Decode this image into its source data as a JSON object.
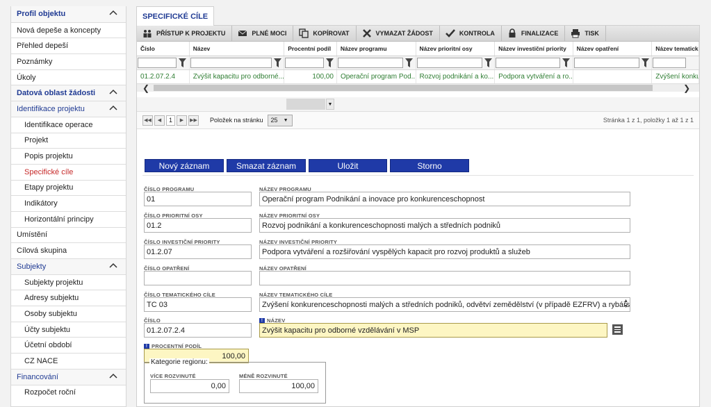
{
  "sidebar": {
    "items": [
      {
        "label": "Profil objektu",
        "kind": "sec",
        "chevron": true
      },
      {
        "label": "Nová depeše a koncepty",
        "kind": "item"
      },
      {
        "label": "Přehled depeší",
        "kind": "item"
      },
      {
        "label": "Poznámky",
        "kind": "item"
      },
      {
        "label": "Úkoly",
        "kind": "item"
      },
      {
        "label": "Datová oblast žádosti",
        "kind": "sec",
        "chevron": true
      },
      {
        "label": "Identifikace projektu",
        "kind": "secplain",
        "chevron": true
      },
      {
        "label": "Identifikace operace",
        "kind": "sub"
      },
      {
        "label": "Projekt",
        "kind": "sub"
      },
      {
        "label": "Popis projektu",
        "kind": "sub"
      },
      {
        "label": "Specifické cíle",
        "kind": "sub",
        "active": true
      },
      {
        "label": "Etapy projektu",
        "kind": "sub"
      },
      {
        "label": "Indikátory",
        "kind": "sub"
      },
      {
        "label": "Horizontální principy",
        "kind": "sub"
      },
      {
        "label": "Umístění",
        "kind": "item"
      },
      {
        "label": "Cílová skupina",
        "kind": "item"
      },
      {
        "label": "Subjekty",
        "kind": "secplain",
        "chevron": true
      },
      {
        "label": "Subjekty projektu",
        "kind": "sub"
      },
      {
        "label": "Adresy subjektu",
        "kind": "sub"
      },
      {
        "label": "Osoby subjektu",
        "kind": "sub"
      },
      {
        "label": "Účty subjektu",
        "kind": "sub"
      },
      {
        "label": "Účetní období",
        "kind": "sub"
      },
      {
        "label": "CZ NACE",
        "kind": "sub"
      },
      {
        "label": "Financování",
        "kind": "secplain",
        "chevron": true
      },
      {
        "label": "Rozpočet roční",
        "kind": "sub"
      }
    ]
  },
  "tab": {
    "label": "SPECIFICKÉ CÍLE"
  },
  "toolbar": {
    "buttons": [
      {
        "label": "PŘÍSTUP K PROJEKTU",
        "icon": "people-icon"
      },
      {
        "label": "PLNÉ MOCI",
        "icon": "envelope-icon"
      },
      {
        "label": "KOPÍROVAT",
        "icon": "copy-icon"
      },
      {
        "label": "VYMAZAT ŽÁDOST",
        "icon": "cross-icon"
      },
      {
        "label": "KONTROLA",
        "icon": "check-icon"
      },
      {
        "label": "FINALIZACE",
        "icon": "lock-icon"
      },
      {
        "label": "TISK",
        "icon": "printer-icon"
      }
    ]
  },
  "grid": {
    "columns": [
      "Číslo",
      "Název",
      "Procentní podíl",
      "Název programu",
      "Název prioritní osy",
      "Název investiční priority",
      "Název opatření",
      "Název tematického"
    ],
    "rows": [
      [
        "01.2.07.2.4",
        "Zvýšit kapacitu pro odborné...",
        "100,00",
        "Operační program Pod...",
        "Rozvoj podnikání a ko...",
        "Podpora vytváření a ro...",
        "",
        "Zvýšení konkur"
      ]
    ]
  },
  "pager": {
    "page": "1",
    "per_page_label": "Položek na stránku",
    "per_page": "25",
    "info": "Stránka 1 z 1, položky 1 až 1 z 1"
  },
  "actions": {
    "new": "Nový záznam",
    "delete": "Smazat záznam",
    "save": "Uložit",
    "cancel": "Storno"
  },
  "form": {
    "cislo_programu": {
      "label": "ČÍSLO PROGRAMU",
      "value": "01"
    },
    "nazev_programu": {
      "label": "NÁZEV PROGRAMU",
      "value": "Operační program Podnikání a inovace pro konkurenceschopnost"
    },
    "cislo_osy": {
      "label": "ČÍSLO PRIORITNÍ OSY",
      "value": "01.2"
    },
    "nazev_osy": {
      "label": "NÁZEV PRIORITNÍ OSY",
      "value": "Rozvoj podnikání a konkurenceschopnosti malých a středních podniků"
    },
    "cislo_priority": {
      "label": "ČÍSLO INVESTIČNÍ PRIORITY",
      "value": "01.2.07"
    },
    "nazev_priority": {
      "label": "NÁZEV INVESTIČNÍ PRIORITY",
      "value": "Podpora vytváření a rozšiřování vyspělých kapacit pro rozvoj produktů a služeb"
    },
    "cislo_opatreni": {
      "label": "ČÍSLO OPATŘENÍ",
      "value": ""
    },
    "nazev_opatreni": {
      "label": "NÁZEV OPATŘENÍ",
      "value": ""
    },
    "cislo_cile": {
      "label": "ČÍSLO TEMATICKÉHO CÍLE",
      "value": "TC 03"
    },
    "nazev_cile": {
      "label": "NÁZEV TEMATICKÉHO CÍLE",
      "value": "Zvýšení konkurenceschopnosti malých a středních podniků, odvětví zemědělství (v případě EZFRV) a rybářství a"
    },
    "cislo": {
      "label": "ČÍSLO",
      "value": "01.2.07.2.4"
    },
    "nazev": {
      "label": "NÁZEV",
      "value": "Zvýšit kapacitu pro odborné vzdělávání v MSP"
    },
    "procentni_podil": {
      "label": "PROCENTNÍ PODÍL",
      "value": "100,00"
    },
    "kategorie": {
      "legend": "Kategorie regionu:",
      "vice_label": "VÍCE ROZVINUTÉ",
      "vice_value": "0,00",
      "mene_label": "MÉNĚ ROZVINUTÉ",
      "mene_value": "100,00"
    }
  },
  "colors": {
    "accent": "#1f3a93",
    "button": "#1f3aa7",
    "active": "#c62828",
    "grid_text": "#2e7d32",
    "required": "#fdf6c3"
  }
}
